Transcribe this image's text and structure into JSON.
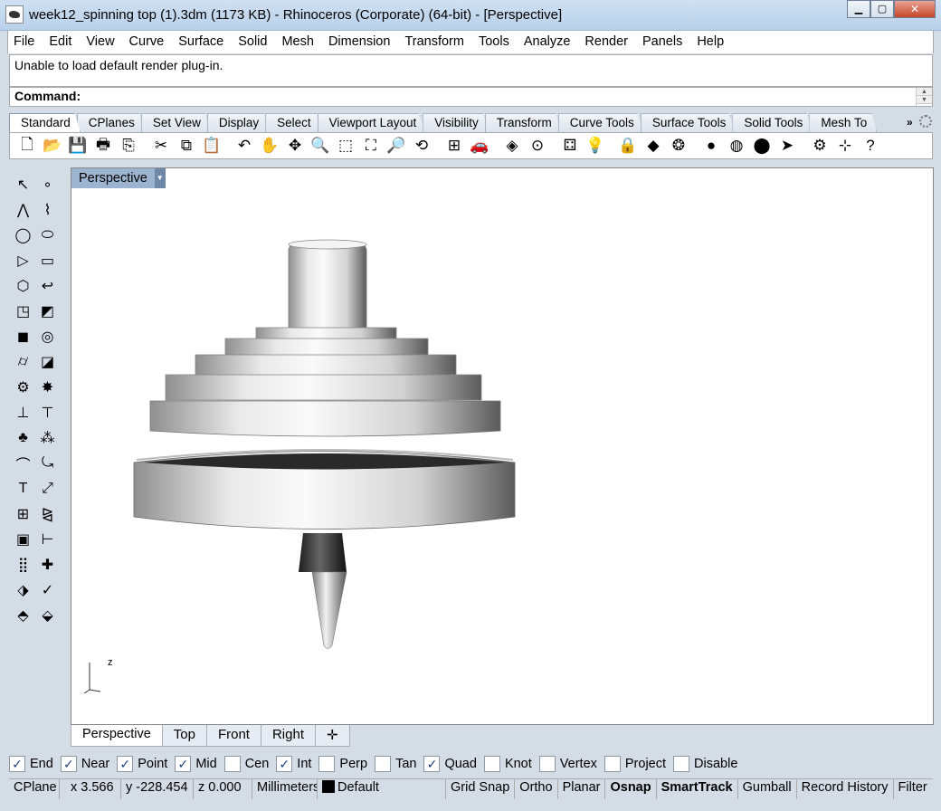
{
  "window": {
    "title": "week12_spinning top  (1).3dm (1173 KB) - Rhinoceros (Corporate) (64-bit) - [Perspective]",
    "minimize": "▁",
    "maximize": "▢",
    "close": "✕"
  },
  "menubar": [
    "File",
    "Edit",
    "View",
    "Curve",
    "Surface",
    "Solid",
    "Mesh",
    "Dimension",
    "Transform",
    "Tools",
    "Analyze",
    "Render",
    "Panels",
    "Help"
  ],
  "command": {
    "history": "Unable to load default render plug-in.",
    "prompt": "Command:",
    "input_value": ""
  },
  "toolbar_tabs": [
    "Standard",
    "CPlanes",
    "Set View",
    "Display",
    "Select",
    "Viewport Layout",
    "Visibility",
    "Transform",
    "Curve Tools",
    "Surface Tools",
    "Solid Tools",
    "Mesh To"
  ],
  "toolbar_more": "»",
  "standard_tools": [
    {
      "name": "new-icon",
      "glyph": "🗋"
    },
    {
      "name": "open-icon",
      "glyph": "📂"
    },
    {
      "name": "save-icon",
      "glyph": "💾"
    },
    {
      "name": "print-icon",
      "glyph": "🖶"
    },
    {
      "name": "import-icon",
      "glyph": "⎘"
    },
    {
      "name": "cut-icon",
      "glyph": "✂"
    },
    {
      "name": "copy-icon",
      "glyph": "⧉"
    },
    {
      "name": "paste-icon",
      "glyph": "📋"
    },
    {
      "name": "undo-icon",
      "glyph": "↶"
    },
    {
      "name": "pan-hand-icon",
      "glyph": "✋"
    },
    {
      "name": "rotate-view-icon",
      "glyph": "✥"
    },
    {
      "name": "zoom-icon",
      "glyph": "🔍"
    },
    {
      "name": "zoom-window-icon",
      "glyph": "⬚"
    },
    {
      "name": "zoom-extents-icon",
      "glyph": "⛶"
    },
    {
      "name": "zoom-selected-icon",
      "glyph": "🔎"
    },
    {
      "name": "rotate-icon",
      "glyph": "⟲"
    },
    {
      "name": "four-viewports-icon",
      "glyph": "⊞"
    },
    {
      "name": "car-icon",
      "glyph": "🚗"
    },
    {
      "name": "render-preview-icon",
      "glyph": "◈"
    },
    {
      "name": "select-point-icon",
      "glyph": "⊙"
    },
    {
      "name": "object-properties-icon",
      "glyph": "⚃"
    },
    {
      "name": "light-bulb-icon",
      "glyph": "💡"
    },
    {
      "name": "lock-icon",
      "glyph": "🔒"
    },
    {
      "name": "layer-icon",
      "glyph": "◆"
    },
    {
      "name": "color-wheel-icon",
      "glyph": "❂"
    },
    {
      "name": "shaded-sphere-icon",
      "glyph": "●"
    },
    {
      "name": "wire-sphere-icon",
      "glyph": "◍"
    },
    {
      "name": "render-sphere-icon",
      "glyph": "⬤"
    },
    {
      "name": "spotlight-icon",
      "glyph": "➤"
    },
    {
      "name": "options-gears-icon",
      "glyph": "⚙"
    },
    {
      "name": "grid-snap-icon",
      "glyph": "⊹"
    },
    {
      "name": "help-icon",
      "glyph": "?"
    }
  ],
  "left_tools": [
    {
      "name": "select-arrow-icon",
      "glyph": "↖"
    },
    {
      "name": "point-icon",
      "glyph": "∘"
    },
    {
      "name": "polyline-icon",
      "glyph": "⋀"
    },
    {
      "name": "curve-icon",
      "glyph": "⌇"
    },
    {
      "name": "circle-icon",
      "glyph": "◯"
    },
    {
      "name": "ellipse-icon",
      "glyph": "⬭"
    },
    {
      "name": "polygon-icon",
      "glyph": "▷"
    },
    {
      "name": "rectangle-icon",
      "glyph": "▭"
    },
    {
      "name": "hexagon-icon",
      "glyph": "⬡"
    },
    {
      "name": "fillet-curve-icon",
      "glyph": "↩"
    },
    {
      "name": "surface-points-icon",
      "glyph": "◳"
    },
    {
      "name": "extrude-surface-icon",
      "glyph": "◩"
    },
    {
      "name": "box-icon",
      "glyph": "◼"
    },
    {
      "name": "sphere-union-icon",
      "glyph": "◎"
    },
    {
      "name": "cylinder-icon",
      "glyph": "⌭"
    },
    {
      "name": "planar-surface-icon",
      "glyph": "◪"
    },
    {
      "name": "transform-gears-icon",
      "glyph": "⚙"
    },
    {
      "name": "explode-icon",
      "glyph": "✸"
    },
    {
      "name": "boolean-split-icon",
      "glyph": "⊥"
    },
    {
      "name": "trim-icon",
      "glyph": "⊤"
    },
    {
      "name": "boolean-union-icon",
      "glyph": "♣"
    },
    {
      "name": "cluster-points-icon",
      "glyph": "⁂"
    },
    {
      "name": "arc-icon",
      "glyph": "⌒"
    },
    {
      "name": "offset-curve-icon",
      "glyph": "⤿"
    },
    {
      "name": "text-icon",
      "glyph": "T"
    },
    {
      "name": "scale-icon",
      "glyph": "⤢"
    },
    {
      "name": "array-icon",
      "glyph": "⊞"
    },
    {
      "name": "mirror-icon",
      "glyph": "⧎"
    },
    {
      "name": "solid-box-icon",
      "glyph": "▣"
    },
    {
      "name": "dimension-icon",
      "glyph": "⊢"
    },
    {
      "name": "grid-array-icon",
      "glyph": "⣿"
    },
    {
      "name": "gumball-icon",
      "glyph": "✚"
    },
    {
      "name": "analyze-icon",
      "glyph": "⬗"
    },
    {
      "name": "check-icon",
      "glyph": "✓"
    },
    {
      "name": "render-shapes-icon",
      "glyph": "⬘"
    },
    {
      "name": "paint-bucket-icon",
      "glyph": "⬙"
    }
  ],
  "viewport": {
    "name": "Perspective",
    "dropdown": "▼",
    "axis_label": "z"
  },
  "viewport_tabs": [
    "Perspective",
    "Top",
    "Front",
    "Right"
  ],
  "viewport_tab_add": "✛",
  "osnaps": [
    {
      "label": "End",
      "checked": true
    },
    {
      "label": "Near",
      "checked": true
    },
    {
      "label": "Point",
      "checked": true
    },
    {
      "label": "Mid",
      "checked": true
    },
    {
      "label": "Cen",
      "checked": false
    },
    {
      "label": "Int",
      "checked": true
    },
    {
      "label": "Perp",
      "checked": false
    },
    {
      "label": "Tan",
      "checked": false
    },
    {
      "label": "Quad",
      "checked": true
    },
    {
      "label": "Knot",
      "checked": false
    },
    {
      "label": "Vertex",
      "checked": false
    },
    {
      "label": "Project",
      "checked": false
    },
    {
      "label": "Disable",
      "checked": false
    }
  ],
  "status": {
    "cplane": "CPlane",
    "x": "x 3.566",
    "y": "y -228.454",
    "z": "z 0.000",
    "units": "Millimeters",
    "layer": "Default",
    "grid_snap": "Grid Snap",
    "ortho": "Ortho",
    "planar": "Planar",
    "osnap": "Osnap",
    "smarttrack": "SmartTrack",
    "gumball": "Gumball",
    "record_history": "Record History",
    "filter": "Filter"
  },
  "colors": {
    "viewport_label_bg": "#9db4d0",
    "title_gradient": "#b9d1ea",
    "close_red": "#c7452a",
    "check_blue": "#1a3e7a"
  }
}
